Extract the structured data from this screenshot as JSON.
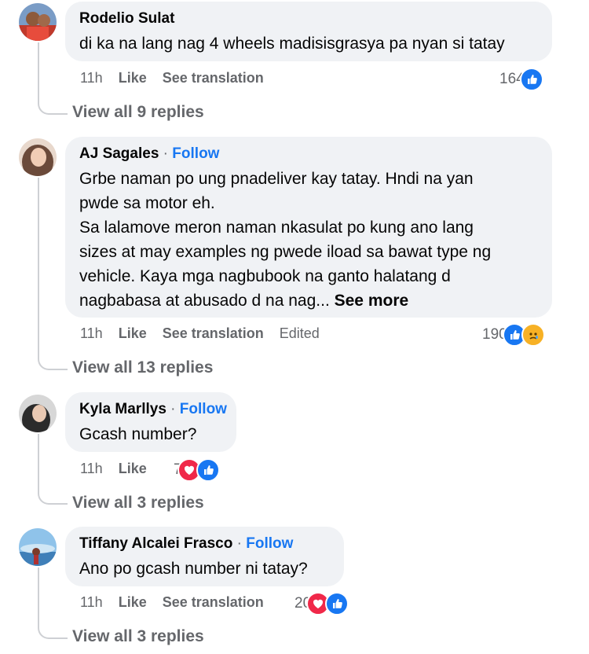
{
  "comments": [
    {
      "author": "Rodelio Sulat",
      "follow": "",
      "text": "di ka na lang nag 4 wheels madisisgrasya pa nyan si tatay",
      "see_more": "",
      "time": "11h",
      "like": "Like",
      "translate": "See translation",
      "edited": "",
      "reaction_count": "164",
      "reactions": [
        "like-icon"
      ],
      "view_replies": "View all 9 replies"
    },
    {
      "author": "AJ Sagales",
      "follow": "Follow",
      "text": "Grbe naman po ung pnadeliver kay tatay. Hndi na yan\npwde sa motor eh.\nSa lalamove meron naman nkasulat po kung ano lang\nsizes at may examples ng pwede iload sa bawat type ng\nvehicle. Kaya mga nagbubook na ganto halatang d\nnagbabasa at abusado d na nag...",
      "see_more": "See more",
      "time": "11h",
      "like": "Like",
      "translate": "See translation",
      "edited": "Edited",
      "reaction_count": "190",
      "reactions": [
        "like-icon",
        "sad-icon"
      ],
      "view_replies": "View all 13 replies"
    },
    {
      "author": "Kyla Marllys",
      "follow": "Follow",
      "text": "Gcash number?",
      "see_more": "",
      "time": "11h",
      "like": "Like",
      "translate": "",
      "edited": "",
      "reaction_count": "7",
      "reactions": [
        "love-icon",
        "like-icon"
      ],
      "view_replies": "View all 3 replies"
    },
    {
      "author": "Tiffany Alcalei Frasco",
      "follow": "Follow",
      "text": "Ano po gcash number ni tatay?",
      "see_more": "",
      "time": "11h",
      "like": "Like",
      "translate": "See translation",
      "edited": "",
      "reaction_count": "20",
      "reactions": [
        "love-icon",
        "like-icon"
      ],
      "view_replies": "View all 3 replies"
    }
  ],
  "colors": {
    "bubble": "#f0f2f5",
    "link": "#1877f2",
    "meta": "#65676b",
    "like": "#1877f2",
    "love": "#f02849",
    "sad": "#f7b125"
  }
}
